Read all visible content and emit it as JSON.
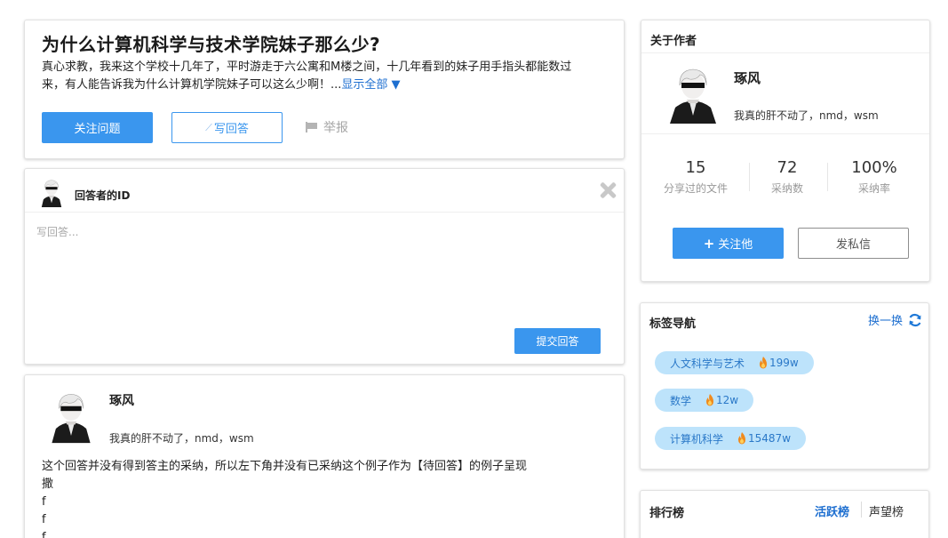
{
  "question": {
    "title": "为什么计算机科学与技术学院妹子那么少?",
    "body": "真心求教，我来这个学校十几年了，平时游走于六公寓和M楼之间，十几年看到的妹子用手指头都能数过来，有人能告诉我为什么计算机学院妹子可以这么少啊！...",
    "more_label": "显示全部 ▼",
    "follow_label": "关注问题",
    "write_label": "写回答",
    "report_label": "举报"
  },
  "editor": {
    "user_id_label": "回答者的ID",
    "placeholder": "写回答...",
    "submit_label": "提交回答"
  },
  "answer": {
    "name": "琢风",
    "signature": "我真的肝不动了，nmd，wsm",
    "lines": [
      "这个回答并没有得到答主的采纳，所以左下角并没有已采纳这个例子作为【待回答】的例子呈现",
      "撒",
      "f",
      "f",
      "f"
    ]
  },
  "author": {
    "section_title": "关于作者",
    "name": "琢风",
    "signature": "我真的肝不动了，nmd，wsm",
    "stats": [
      {
        "value": "15",
        "label": "分享过的文件"
      },
      {
        "value": "72",
        "label": "采纳数"
      },
      {
        "value": "100%",
        "label": "采纳率"
      }
    ],
    "follow_label": "关注他",
    "message_label": "发私信"
  },
  "tags": {
    "title": "标签导航",
    "refresh_label": "换一换",
    "items": [
      {
        "name": "人文科学与艺术",
        "hot": "199w"
      },
      {
        "name": "数学",
        "hot": "12w"
      },
      {
        "name": "计算机科学",
        "hot": "15487w"
      }
    ]
  },
  "ranking": {
    "title": "排行榜",
    "tab_active": "活跃榜",
    "tab_other": "声望榜"
  },
  "colors": {
    "primary": "#3a96ee",
    "link": "#1e6fd0",
    "tag_bg": "#bde3fb",
    "fire": "#f08a1c"
  },
  "icons": {
    "report": "flag-icon",
    "write": "pen-icon",
    "close": "close-icon",
    "refresh": "refresh-icon",
    "hot": "fire-icon",
    "follow": "plus-icon"
  }
}
